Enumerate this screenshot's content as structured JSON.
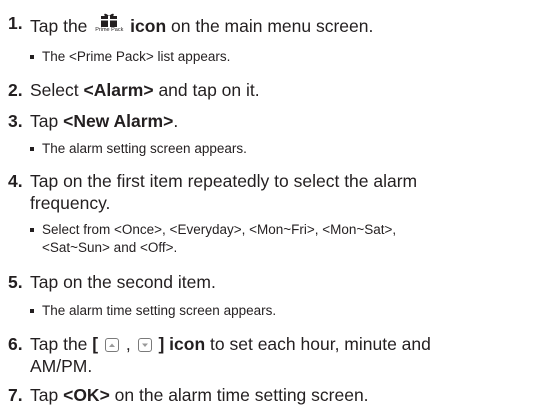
{
  "steps": [
    {
      "number": "1.",
      "pre": "Tap the",
      "icon_caption": "Prime Pack",
      "icon_name": "prime-pack-icon",
      "bold": "icon",
      "post": "on the main menu screen.",
      "note": "The <Prime Pack> list appears."
    },
    {
      "number": "2.",
      "pre": "Select",
      "bold": "<Alarm>",
      "post": "and tap on it."
    },
    {
      "number": "3.",
      "pre": "Tap",
      "bold": "<New Alarm>",
      "post": ".",
      "note": "The alarm setting screen appears."
    },
    {
      "number": "4.",
      "line1": "Tap on the first item repeatedly to select the alarm",
      "line2": "frequency.",
      "note_line1": "Select from <Once>, <Everyday>, <Mon~Fri>, <Mon~Sat>,",
      "note_line2": "<Sat~Sun> and <Off>."
    },
    {
      "number": "5.",
      "text": "Tap on the second item.",
      "note": "The alarm time setting screen appears."
    },
    {
      "number": "6.",
      "pre": "Tap the",
      "bold_open": "[",
      "separator": ",",
      "bold_close": "] icon",
      "post": "to set each hour, minute and",
      "line2": "AM/PM.",
      "up_icon": "up-arrow-icon",
      "down_icon": "down-arrow-icon"
    },
    {
      "number": "7.",
      "pre": "Tap",
      "bold": "<OK>",
      "post": "on the alarm time setting screen."
    }
  ]
}
